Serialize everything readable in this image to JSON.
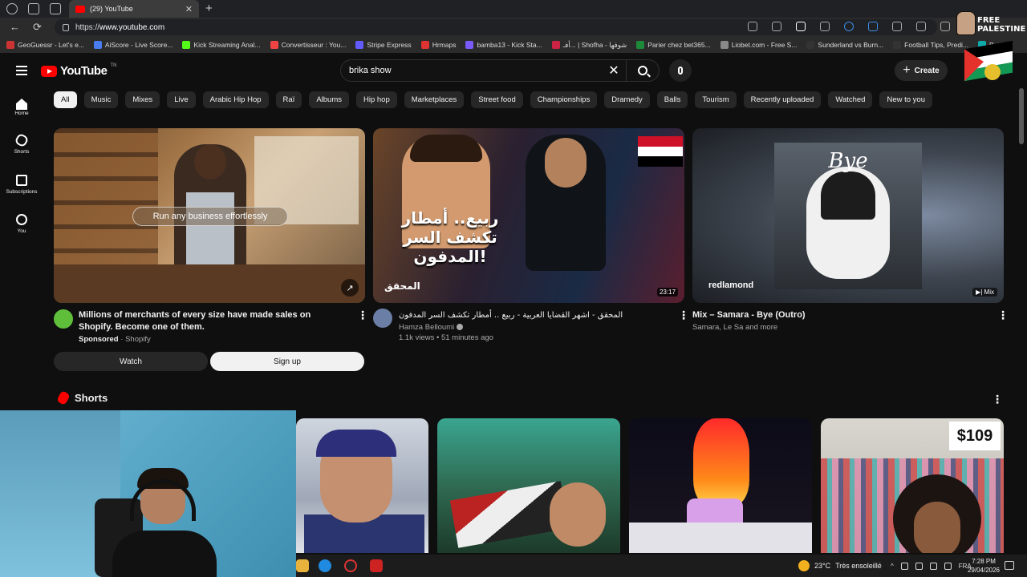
{
  "browser": {
    "tab_title": "(29) YouTube",
    "url_prefix": "https://",
    "url_host": "www.youtube.com",
    "bookmarks": [
      {
        "label": "GeoGuessr - Let's e...",
        "color": "#c33"
      },
      {
        "label": "AiScore - Live Score...",
        "color": "#4a7cf0"
      },
      {
        "label": "Kick Streaming Anal...",
        "color": "#53fc18"
      },
      {
        "label": "Convertisseur : You...",
        "color": "#e44"
      },
      {
        "label": "Stripe Express",
        "color": "#635bff"
      },
      {
        "label": "Hrmaps",
        "color": "#d33"
      },
      {
        "label": "bamba13 - Kick Sta...",
        "color": "#7a5af8"
      },
      {
        "label": "أفـ... | Shofha - شوفها",
        "color": "#c24"
      },
      {
        "label": "Parier chez bet365...",
        "color": "#1d8a3a"
      },
      {
        "label": "Liobet.com - Free S...",
        "color": "#888"
      },
      {
        "label": "Sunderland vs Burn...",
        "color": "#333"
      },
      {
        "label": "Football Tips, Predi...",
        "color": "#333"
      },
      {
        "label": "Bet Th",
        "color": "#1aa"
      }
    ]
  },
  "overlay": {
    "flag_text_line1": "FREE",
    "flag_text_line2": "PALESTINE"
  },
  "header": {
    "logo_text": "YouTube",
    "logo_region": "TN",
    "search_value": "brika show",
    "create_label": "Create"
  },
  "guide": {
    "items": [
      {
        "label": "Home",
        "icon": "home-icon"
      },
      {
        "label": "Shorts",
        "icon": "shorts-icon"
      },
      {
        "label": "Subscriptions",
        "icon": "subscriptions-icon"
      },
      {
        "label": "You",
        "icon": "you-icon"
      }
    ]
  },
  "chips": [
    "All",
    "Music",
    "Mixes",
    "Live",
    "Arabic Hip Hop",
    "Raï",
    "Albums",
    "Hip hop",
    "Marketplaces",
    "Street food",
    "Championships",
    "Dramedy",
    "Balls",
    "Tourism",
    "Recently uploaded",
    "Watched",
    "New to you"
  ],
  "videos": {
    "ad": {
      "overlay_text": "Run any business effortlessly",
      "title": "Millions of merchants of every size have made sales on Shopify. Become one of them.",
      "sponsored": "Sponsored",
      "channel": "Shopify",
      "watch_label": "Watch",
      "signup_label": "Sign up"
    },
    "v2": {
      "thumb_title": "ربيع.. أمطار تكشف السر المدفون!",
      "thumb_brand": "المحقق",
      "duration": "23:17",
      "title": "المحقق - اشهر القضايا العربية - ربيع .. أمطار تكشف السر المدفون",
      "channel": "Hamza Belloumi",
      "views": "1.1k views",
      "age": "51 minutes ago"
    },
    "v3": {
      "thumb_title": "Bye",
      "thumb_brand": "redlamond",
      "badge": "Mix",
      "title": "Mix – Samara - Bye (Outro)",
      "subtitle": "Samara, Le Sa and more"
    }
  },
  "shorts": {
    "title": "Shorts",
    "price_tag": "$109"
  },
  "taskbar": {
    "temperature": "23°C",
    "weather": "Très ensoleillé",
    "lang": "FRA",
    "time": "7:28 PM",
    "date": "29/04/2026"
  }
}
